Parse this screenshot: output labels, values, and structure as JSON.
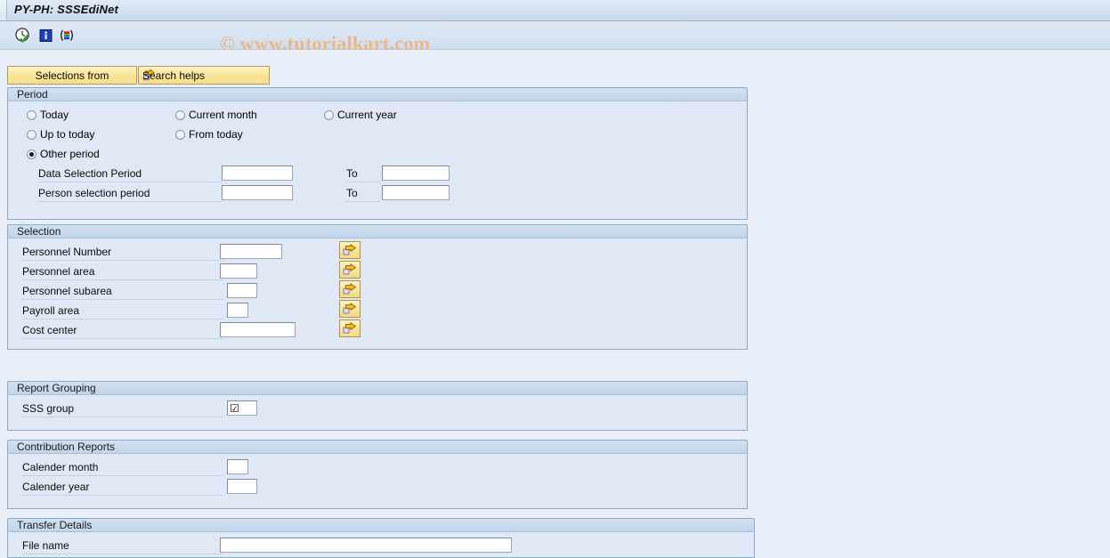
{
  "window": {
    "title": "PY-PH: SSSEdiNet"
  },
  "watermark": {
    "text": "© www.tutorialkart.com"
  },
  "toolbar": {
    "items": [
      {
        "name": "execute-clock-icon",
        "tooltip": "Execute"
      },
      {
        "name": "info-icon",
        "tooltip": "Information"
      },
      {
        "name": "get-variant-icon",
        "tooltip": "Get Variant"
      }
    ]
  },
  "tabs": [
    {
      "label": "Selections from",
      "icon": null
    },
    {
      "label": "Search helps",
      "icon": "arrow-right-icon"
    }
  ],
  "sections": {
    "period": {
      "title": "Period",
      "radios": [
        {
          "label": "Today",
          "selected": false
        },
        {
          "label": "Current month",
          "selected": false
        },
        {
          "label": "Current year",
          "selected": false
        },
        {
          "label": "Up to today",
          "selected": false
        },
        {
          "label": "From today",
          "selected": false
        },
        {
          "label": "Other period",
          "selected": true
        }
      ],
      "rows": [
        {
          "label": "Data Selection Period",
          "value": "",
          "to_label": "To",
          "to_value": ""
        },
        {
          "label": "Person selection period",
          "value": "",
          "to_label": "To",
          "to_value": ""
        }
      ]
    },
    "selection": {
      "title": "Selection",
      "rows": [
        {
          "label": "Personnel Number",
          "value": "",
          "button": "multiple-selection-icon"
        },
        {
          "label": "Personnel area",
          "value": "",
          "button": "multiple-selection-icon"
        },
        {
          "label": "Personnel subarea",
          "value": "",
          "button": "multiple-selection-icon"
        },
        {
          "label": "Payroll area",
          "value": "",
          "button": "multiple-selection-icon"
        },
        {
          "label": "Cost center",
          "value": "",
          "button": "multiple-selection-icon"
        }
      ]
    },
    "report_grouping": {
      "title": "Report Grouping",
      "rows": [
        {
          "label": "SSS group",
          "value": "☑"
        }
      ]
    },
    "contribution_reports": {
      "title": "Contribution Reports",
      "rows": [
        {
          "label": "Calender month",
          "value": ""
        },
        {
          "label": "Calender year",
          "value": ""
        }
      ]
    },
    "transfer_details": {
      "title": "Transfer Details",
      "rows": [
        {
          "label": "File name",
          "value": ""
        }
      ]
    }
  },
  "colors": {
    "page_bg": "#e8eef7",
    "group_bg": "#dfe8f4",
    "group_border": "#8fa9c6",
    "button_yellow": "#f8e49a",
    "watermark": "#e9b98b",
    "title_text": "#101010"
  }
}
